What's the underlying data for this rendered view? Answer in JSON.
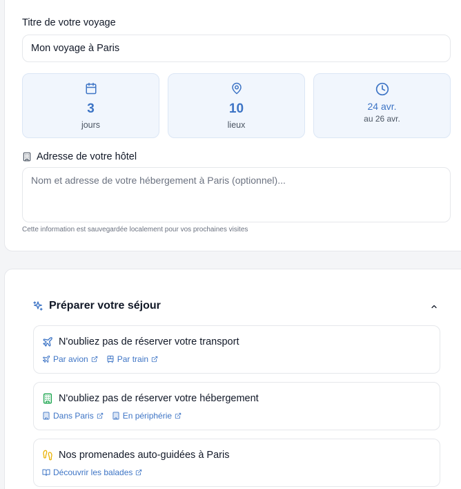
{
  "trip": {
    "title_label": "Titre de votre voyage",
    "title_value": "Mon voyage à Paris"
  },
  "stats": {
    "days": {
      "icon": "calendar-icon",
      "value": "3",
      "label": "jours"
    },
    "places": {
      "icon": "map-pin-icon",
      "value": "10",
      "label": "lieux"
    },
    "dates": {
      "icon": "clock-icon",
      "start": "24 avr.",
      "end": "au 26 avr."
    }
  },
  "hotel": {
    "icon": "building-icon",
    "label": "Adresse de votre hôtel",
    "placeholder": "Nom et adresse de votre hébergement à Paris (optionnel)...",
    "value": "",
    "note": "Cette information est sauvegardée localement pour vos prochaines visites"
  },
  "prepare": {
    "icon": "sparkles-icon",
    "title": "Préparer votre séjour",
    "collapse_icon": "chevron-up-icon",
    "items": [
      {
        "icon": "plane-icon",
        "title": "N'oubliez pas de réserver votre transport",
        "links": [
          {
            "icon": "plane-icon",
            "label": "Par avion",
            "ext_icon": "external-link-icon"
          },
          {
            "icon": "train-icon",
            "label": "Par train",
            "ext_icon": "external-link-icon"
          }
        ]
      },
      {
        "icon": "building-icon",
        "title": "N'oubliez pas de réserver votre hébergement",
        "links": [
          {
            "icon": "building-icon",
            "label": "Dans Paris",
            "ext_icon": "external-link-icon"
          },
          {
            "icon": "building-icon",
            "label": "En périphérie",
            "ext_icon": "external-link-icon"
          }
        ]
      },
      {
        "icon": "footprints-icon",
        "title": "Nos promenades auto-guidées à Paris",
        "links": [
          {
            "icon": "book-open-icon",
            "label": "Découvrir les balades",
            "ext_icon": "external-link-icon"
          }
        ]
      }
    ]
  },
  "colors": {
    "accent": "#3d74c5",
    "stat_bg": "#f1f6fd",
    "green": "#16a34a",
    "amber": "#eab308"
  }
}
